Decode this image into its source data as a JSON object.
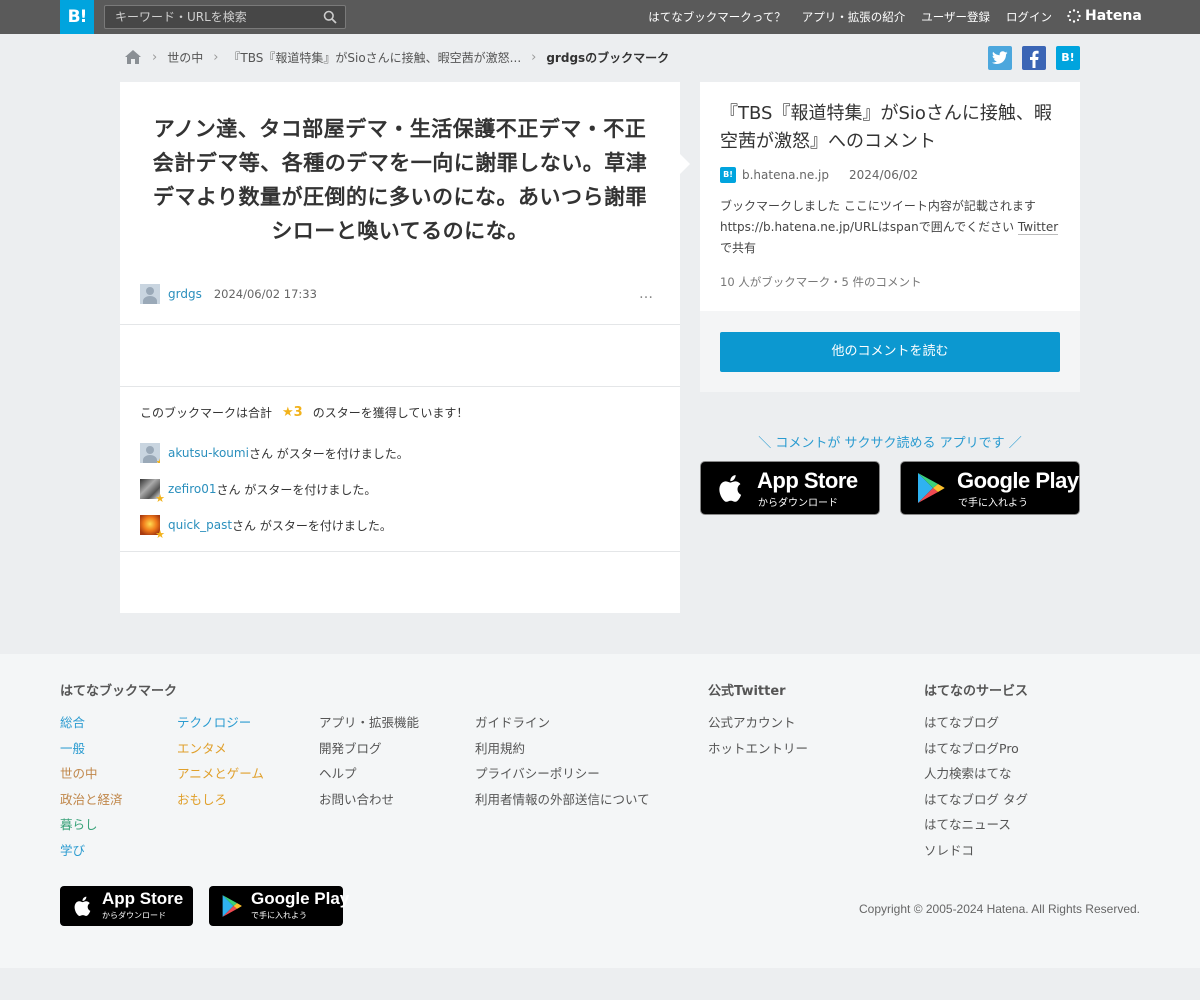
{
  "header": {
    "logo": "B!",
    "search_placeholder": "キーワード・URLを検索",
    "nav": [
      "はてなブックマークって？",
      "アプリ・拡張の紹介",
      "ユーザー登録",
      "ログイン"
    ],
    "brand": "Hatena"
  },
  "breadcrumb": {
    "items": [
      "世の中",
      "『TBS『報道特集』がSioさんに接触、暇空茜が激怒...",
      "grdgsのブックマーク"
    ]
  },
  "share": {
    "hatena": "B!"
  },
  "comment": {
    "text": "アノン達、タコ部屋デマ・生活保護不正デマ・不正会計デマ等、各種のデマを一向に謝罪しない。草津デマより数量が圧倒的に多いのにな。あいつら謝罪シローと喚いてるのにな。",
    "user": "grdgs",
    "date": "2024/06/02 17:33",
    "more": "…"
  },
  "stars": {
    "summary_prefix": "このブックマークは合計",
    "count": "★3",
    "summary_suffix": "のスターを獲得しています！",
    "suffix_text": "さん がスターを付けました。",
    "users": [
      {
        "name": "akutsu-koumi"
      },
      {
        "name": "zefiro01"
      },
      {
        "name": "quick_past"
      }
    ]
  },
  "entry": {
    "title": "『TBS『報道特集』がSioさんに接触、暇空茜が激怒』へのコメント",
    "favicon": "B!",
    "domain": "b.hatena.ne.jp",
    "date": "2024/06/02",
    "desc_part1": "ブックマークしました ここにツイート内容が記載されます https://b.hatena.ne.jp/URLはspanで囲んでください ",
    "desc_link": "Twitter",
    "desc_part2": "で共有",
    "counts": "10 人がブックマーク・5 件のコメント",
    "read_button": "他のコメントを読む"
  },
  "app_promo": {
    "text": "＼ コメントが サクサク読める アプリです ／",
    "appstore_big": "App Store",
    "appstore_small": "からダウンロード",
    "googleplay_big": "Google Play",
    "googleplay_small": "で手に入れよう"
  },
  "footer": {
    "hb_title": "はてなブックマーク",
    "cat_col1": [
      "総合",
      "一般",
      "世の中",
      "政治と経済",
      "暮らし",
      "学び"
    ],
    "cat_col2": [
      "テクノロジー",
      "エンタメ",
      "アニメとゲーム",
      "おもしろ"
    ],
    "links_col3": [
      "アプリ・拡張機能",
      "開発ブログ",
      "ヘルプ",
      "お問い合わせ"
    ],
    "links_col4": [
      "ガイドライン",
      "利用規約",
      "プライバシーポリシー",
      "利用者情報の外部送信について"
    ],
    "twitter_title": "公式Twitter",
    "twitter_links": [
      "公式アカウント",
      "ホットエントリー"
    ],
    "services_title": "はてなのサービス",
    "services": [
      "はてなブログ",
      "はてなブログPro",
      "人力検索はてな",
      "はてなブログ タグ",
      "はてなニュース",
      "ソレドコ"
    ],
    "copyright": "Copyright © 2005-2024 Hatena. All Rights Reserved."
  },
  "colors": {
    "accent": "#00a4de",
    "button": "#0c98d0",
    "star": "#f2b21b",
    "link": "#2a8fbd"
  }
}
